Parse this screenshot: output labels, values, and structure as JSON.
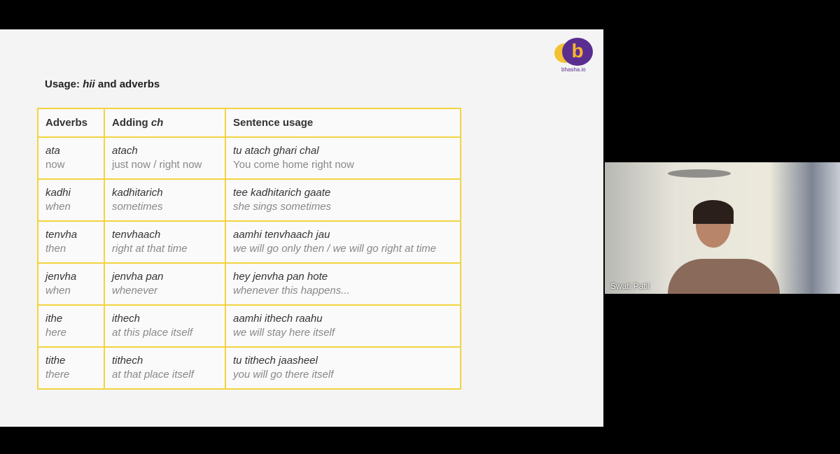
{
  "slide": {
    "title_prefix": "Usage: ",
    "title_italic": "hii",
    "title_suffix": " and adverbs",
    "logo_text": "bhasha.io",
    "logo_letter": "b",
    "table": {
      "headers": {
        "adverbs": "Adverbs",
        "adding_prefix": "Adding ",
        "adding_italic": "ch",
        "sentence": "Sentence usage"
      },
      "rows": [
        {
          "adverb": "ata",
          "adverb_en": "now",
          "ch": "atach",
          "ch_en": "just now / right now",
          "sentence": "tu atach ghari chal",
          "sentence_en": "You come home right now"
        },
        {
          "adverb": "kadhi",
          "adverb_en": "when",
          "ch": "kadhitarich",
          "ch_en": "sometimes",
          "sentence": "tee kadhitarich gaate",
          "sentence_en": "she sings sometimes"
        },
        {
          "adverb": "tenvha",
          "adverb_en": "then",
          "ch": "tenvhaach",
          "ch_en": "right at that time",
          "sentence": "aamhi tenvhaach jau",
          "sentence_en": "we will go only then / we will go right at time"
        },
        {
          "adverb": "jenvha",
          "adverb_en": "when",
          "ch": "jenvha pan",
          "ch_en": "whenever",
          "sentence": "hey jenvha pan hote",
          "sentence_en": "whenever this happens..."
        },
        {
          "adverb": "ithe",
          "adverb_en": "here",
          "ch": "ithech",
          "ch_en": "at this place itself",
          "sentence": "aamhi ithech raahu",
          "sentence_en": "we will stay here itself"
        },
        {
          "adverb": "tithe",
          "adverb_en": "there",
          "ch": "tithech",
          "ch_en": "at that place itself",
          "sentence": "tu tithech jaasheel",
          "sentence_en": "you will go there itself"
        }
      ]
    }
  },
  "participant": {
    "name": "Swati Patil"
  },
  "colors": {
    "table_border": "#f3d340",
    "logo_purple": "#5a2d91",
    "logo_yellow": "#f2c230"
  }
}
